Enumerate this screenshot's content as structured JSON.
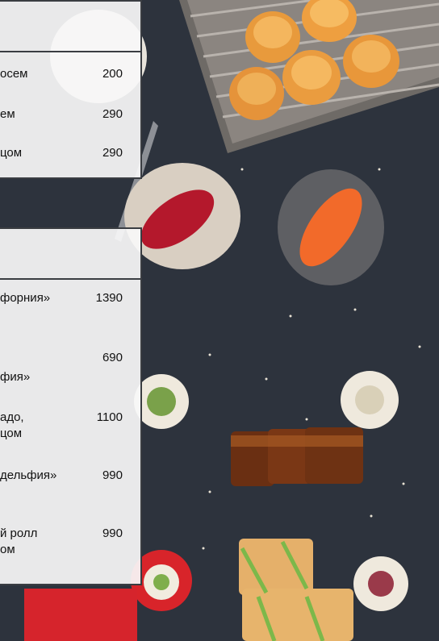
{
  "menu_top": {
    "items": [
      {
        "name": "осем",
        "price": "200"
      },
      {
        "name": "ем",
        "price": "290"
      },
      {
        "name": "цом",
        "price": "290"
      }
    ]
  },
  "menu_bottom": {
    "items": [
      {
        "name": "форния»",
        "price": "1390"
      },
      {
        "name": "фия»",
        "price": "690"
      },
      {
        "name": "адо,\nцом",
        "price": "1100"
      },
      {
        "name": "дельфия»",
        "price": "990"
      },
      {
        "name": "й ролл\nом",
        "price": "990"
      }
    ]
  }
}
